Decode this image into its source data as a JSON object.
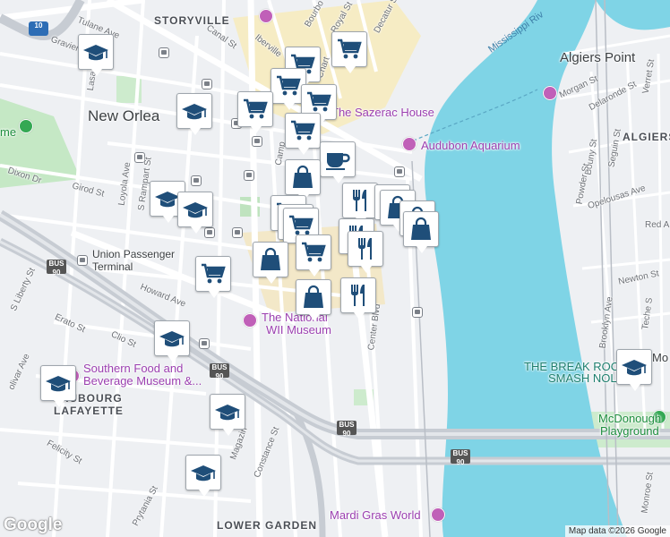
{
  "map": {
    "attribution": "Map data ©2026 Google",
    "logo": "Google",
    "colors": {
      "water": "#7fd4e6",
      "land": "#eef0f3",
      "park": "#c5e8c5",
      "quarter": "#f6ecc4",
      "road": "#ffffff",
      "highway": "#c7ccd3",
      "marker_icon": "#1f4e79"
    }
  },
  "labels": {
    "neighborhoods": [
      "STORYVILLE",
      "ALGIERS",
      "FAUBOURG",
      "LAFAYETTE",
      "LOWER GARDEN"
    ],
    "city": "New Orlea",
    "water": [
      "Mississippi Riv"
    ],
    "places": {
      "algiers_point": "Algiers Point",
      "sazerac": "The Sazerac House",
      "aquarium": "Audubon Aquarium",
      "ww2_museum_line1": "The National",
      "ww2_museum_line2": "WII Museum",
      "southern_food_line1": "Southern Food and",
      "southern_food_line2": "Beverage Museum &...",
      "break_room_line1": "THE BREAK ROO",
      "break_room_line2": "SMASH NOL",
      "mcdonogh_line1": "McDonough",
      "mcdonogh_line2": "Playground",
      "mardi_gras": "Mardi Gras World",
      "union_line1": "Union Passenger",
      "union_line2": "Terminal",
      "me": "me",
      "mo": "Mo",
      "red": "Red A"
    },
    "streets": {
      "tulane": "Tulane Ave",
      "gravier": "Gravier",
      "canal": "Canal St",
      "iberville": "Iberville",
      "bourbon": "Bourbo",
      "royal": "Royal St",
      "decatur": "Decatur St",
      "chartres": "Chart",
      "rampart": "S Rampart St",
      "loyola": "Loyola Ave",
      "dixon": "Dixon Dr",
      "girod": "Girod St",
      "camp": "Camp",
      "howard": "Howard Ave",
      "liberty": "S Liberty St",
      "erato": "Erato St",
      "clio": "Clio St",
      "olivar": "olivar Ave",
      "felicity": "Felicity St",
      "prytania": "Prytania St",
      "magazine": "Magazin",
      "constance": "Constance St",
      "center": "Center Blvd",
      "morgan": "Morgan St",
      "delaronde": "Delaronde St",
      "verret": "Verret St",
      "bouny": "Bouny St",
      "seguin": "Seguin St",
      "powder": "Powder St",
      "opelousas": "Opelousas Ave",
      "newton": "Newton St",
      "brooklyn": "Brooklyn Ave",
      "teche": "Teche S",
      "monroe": "Monroe St",
      "lasalle": "Lasa",
      "bus90": "BUS 90",
      "i10": "10"
    }
  },
  "markers": [
    {
      "id": "school-1",
      "icon": "graduation-cap-icon"
    },
    {
      "id": "shopping-cart-1",
      "icon": "shopping-cart-icon"
    },
    {
      "id": "shopping-cart-2",
      "icon": "shopping-cart-icon"
    },
    {
      "id": "shopping-cart-3",
      "icon": "shopping-cart-icon"
    },
    {
      "id": "shopping-cart-4",
      "icon": "shopping-cart-icon"
    },
    {
      "id": "school-2",
      "icon": "graduation-cap-icon"
    },
    {
      "id": "shopping-cart-5",
      "icon": "shopping-cart-icon"
    },
    {
      "id": "shopping-cart-6",
      "icon": "shopping-cart-icon"
    },
    {
      "id": "cafe-1",
      "icon": "coffee-cup-icon"
    },
    {
      "id": "shopping-bag-1",
      "icon": "shopping-bag-icon"
    },
    {
      "id": "school-3",
      "icon": "graduation-cap-icon"
    },
    {
      "id": "school-4",
      "icon": "graduation-cap-icon"
    },
    {
      "id": "shopping-cart-7",
      "icon": "shopping-cart-icon"
    },
    {
      "id": "restaurant-1",
      "icon": "fork-knife-icon"
    },
    {
      "id": "shopping-cart-8",
      "icon": "shopping-cart-icon"
    },
    {
      "id": "restaurant-2",
      "icon": "fork-knife-icon"
    },
    {
      "id": "shopping-bag-2",
      "icon": "shopping-bag-icon"
    },
    {
      "id": "shopping-bag-3",
      "icon": "shopping-bag-icon"
    },
    {
      "id": "shopping-bag-4",
      "icon": "shopping-bag-icon"
    },
    {
      "id": "shopping-cart-9",
      "icon": "shopping-cart-icon"
    },
    {
      "id": "shopping-cart-10",
      "icon": "shopping-cart-icon"
    },
    {
      "id": "restaurant-3",
      "icon": "fork-knife-icon"
    },
    {
      "id": "restaurant-4",
      "icon": "fork-knife-icon"
    },
    {
      "id": "shopping-bag-5",
      "icon": "shopping-bag-icon"
    },
    {
      "id": "shopping-bag-6",
      "icon": "shopping-bag-icon"
    },
    {
      "id": "restaurant-5",
      "icon": "fork-knife-icon"
    },
    {
      "id": "shopping-cart-11",
      "icon": "shopping-cart-icon"
    },
    {
      "id": "school-5",
      "icon": "graduation-cap-icon"
    },
    {
      "id": "school-6",
      "icon": "graduation-cap-icon"
    },
    {
      "id": "school-7",
      "icon": "graduation-cap-icon"
    },
    {
      "id": "school-8",
      "icon": "graduation-cap-icon"
    },
    {
      "id": "school-9",
      "icon": "graduation-cap-icon"
    }
  ]
}
